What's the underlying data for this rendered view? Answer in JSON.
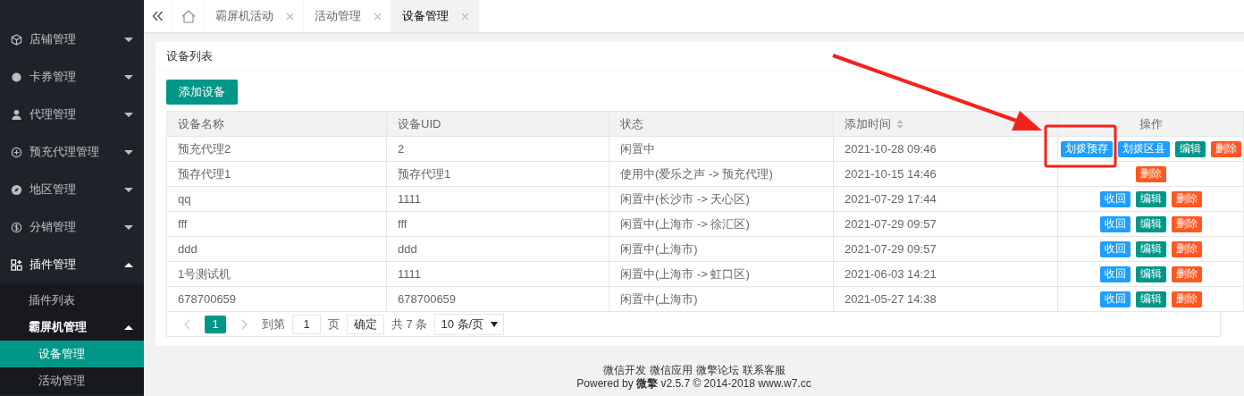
{
  "sidebar": {
    "items": [
      {
        "label": "店铺管理",
        "expanded": false
      },
      {
        "label": "卡券管理",
        "expanded": false
      },
      {
        "label": "代理管理",
        "expanded": false
      },
      {
        "label": "预充代理管理",
        "expanded": false
      },
      {
        "label": "地区管理",
        "expanded": false
      },
      {
        "label": "分销管理",
        "expanded": false
      },
      {
        "label": "插件管理",
        "expanded": true,
        "children": [
          {
            "label": "插件列表",
            "expanded": false
          },
          {
            "label": "霸屏机管理",
            "expanded": true,
            "children": [
              {
                "label": "设备管理",
                "selected": true
              },
              {
                "label": "活动管理",
                "selected": false
              }
            ]
          }
        ]
      }
    ]
  },
  "tabs": [
    {
      "label": "霸屏机活动",
      "selected": false
    },
    {
      "label": "活动管理",
      "selected": false
    },
    {
      "label": "设备管理",
      "selected": true
    }
  ],
  "card": {
    "title": "设备列表",
    "add_button": "添加设备"
  },
  "table": {
    "columns": [
      {
        "label": "设备名称",
        "sortable": false
      },
      {
        "label": "设备UID",
        "sortable": false
      },
      {
        "label": "状态",
        "sortable": false
      },
      {
        "label": "添加时间",
        "sortable": true
      },
      {
        "label": "操作",
        "sortable": false
      }
    ],
    "rows": [
      {
        "cells": [
          "预充代理2",
          "2",
          "闲置中",
          "2021-10-28 09:46"
        ],
        "actions": [
          {
            "label": "划拨预存",
            "kind": "normal"
          },
          {
            "label": "划拨区县",
            "kind": "normal"
          },
          {
            "label": "编辑",
            "kind": "edit"
          },
          {
            "label": "删除",
            "kind": "danger"
          }
        ]
      },
      {
        "cells": [
          "预存代理1",
          "预存代理1",
          "使用中(爱乐之声 -> 预充代理)",
          "2021-10-15 14:46"
        ],
        "actions": [
          {
            "label": "删除",
            "kind": "danger"
          }
        ]
      },
      {
        "cells": [
          "qq",
          "1111",
          "闲置中(长沙市 -> 天心区)",
          "2021-07-29 17:44"
        ],
        "actions": [
          {
            "label": "收回",
            "kind": "normal"
          },
          {
            "label": "编辑",
            "kind": "edit"
          },
          {
            "label": "删除",
            "kind": "danger"
          }
        ]
      },
      {
        "cells": [
          "fff",
          "fff",
          "闲置中(上海市 -> 徐汇区)",
          "2021-07-29 09:57"
        ],
        "actions": [
          {
            "label": "收回",
            "kind": "normal"
          },
          {
            "label": "编辑",
            "kind": "edit"
          },
          {
            "label": "删除",
            "kind": "danger"
          }
        ]
      },
      {
        "cells": [
          "ddd",
          "ddd",
          "闲置中(上海市)",
          "2021-07-29 09:57"
        ],
        "actions": [
          {
            "label": "收回",
            "kind": "normal"
          },
          {
            "label": "编辑",
            "kind": "edit"
          },
          {
            "label": "删除",
            "kind": "danger"
          }
        ]
      },
      {
        "cells": [
          "1号测试机",
          "1111",
          "闲置中(上海市 -> 虹口区)",
          "2021-06-03 14:21"
        ],
        "actions": [
          {
            "label": "收回",
            "kind": "normal"
          },
          {
            "label": "编辑",
            "kind": "edit"
          },
          {
            "label": "删除",
            "kind": "danger"
          }
        ]
      },
      {
        "cells": [
          "678700659",
          "678700659",
          "闲置中(上海市)",
          "2021-05-27 14:38"
        ],
        "actions": [
          {
            "label": "收回",
            "kind": "normal"
          },
          {
            "label": "编辑",
            "kind": "edit"
          },
          {
            "label": "删除",
            "kind": "danger"
          }
        ]
      }
    ]
  },
  "pagination": {
    "pages": [
      {
        "label": "1",
        "selected": true
      }
    ],
    "goto_label": "到第",
    "page_input": "1",
    "page_unit": "页",
    "confirm": "确定",
    "total": "共 7 条",
    "page_size": "10 条/页"
  },
  "footer": {
    "links": [
      "微信开发",
      "微信应用",
      "微擎论坛",
      "联系客服"
    ],
    "powered": "Powered by **微擎** v2.5.7 © 2014-2018 www.w7.cc"
  }
}
